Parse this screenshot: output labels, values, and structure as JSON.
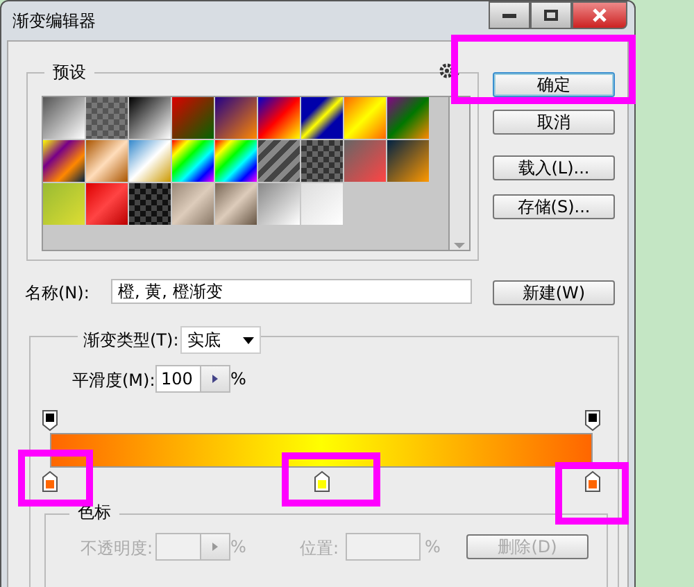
{
  "window": {
    "title": "渐变编辑器"
  },
  "presets": {
    "legend": "预设"
  },
  "buttons": [
    {
      "label": "确定",
      "default": true
    },
    {
      "label": "取消",
      "default": false
    },
    {
      "label": "载入(L)...",
      "default": false
    },
    {
      "label": "存储(S)...",
      "default": false
    }
  ],
  "name": {
    "label": "名称(N):",
    "value": "橙, 黄, 橙渐变",
    "new_button": "新建(W)"
  },
  "gradient": {
    "type_label": "渐变类型(T):",
    "type_value": "实底",
    "smoothness_label": "平滑度(M):",
    "smoothness_value": "100",
    "smoothness_unit": "%",
    "opacity_stops": [
      {
        "color": "#000000",
        "level": 0
      },
      {
        "color": "#000000",
        "level": 1
      }
    ],
    "color_stops": [
      {
        "color": "#ff6600",
        "level": 0
      },
      {
        "color": "#ffff00",
        "level": 0.5
      },
      {
        "color": "#ff6600",
        "level": 1
      }
    ]
  },
  "stops_group": {
    "legend": "色标",
    "opacity_label": "不透明度:",
    "opacity_unit": "%",
    "location_label": "位置:",
    "location_unit": "%",
    "delete_button": "删除(D)",
    "disabled": true
  }
}
